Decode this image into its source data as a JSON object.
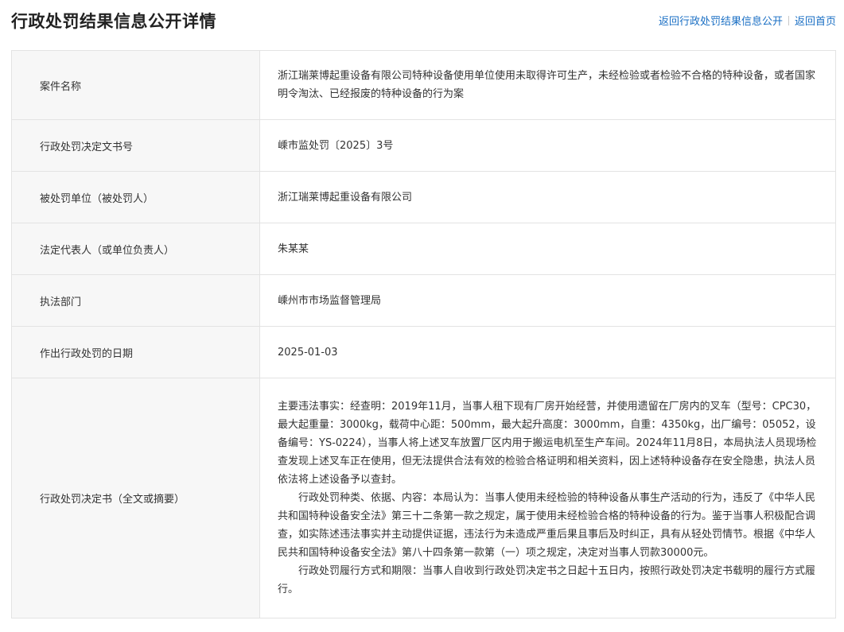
{
  "header": {
    "title": "行政处罚结果信息公开详情",
    "nav_back_list": "返回行政处罚结果信息公开",
    "nav_home": "返回首页"
  },
  "rows": [
    {
      "label": "案件名称",
      "value": "浙江瑞莱博起重设备有限公司特种设备使用单位使用未取得许可生产，未经检验或者检验不合格的特种设备，或者国家明令淘汰、已经报废的特种设备的行为案"
    },
    {
      "label": "行政处罚决定文书号",
      "value": "嵊市监处罚〔2025〕3号"
    },
    {
      "label": "被处罚单位（被处罚人）",
      "value": "浙江瑞莱博起重设备有限公司"
    },
    {
      "label": "法定代表人（或单位负责人）",
      "value": "朱某某"
    },
    {
      "label": "执法部门",
      "value": "嵊州市市场监督管理局"
    },
    {
      "label": "作出行政处罚的日期",
      "value": "2025-01-03"
    },
    {
      "label": "行政处罚决定书（全文或摘要）",
      "paragraphs": [
        "主要违法事实：经查明：2019年11月，当事人租下现有厂房开始经营，并使用遗留在厂房内的叉车（型号：CPC30，最大起重量：3000kg，载荷中心距：500mm，最大起升高度：3000mm，自重：4350kg，出厂编号：05052，设备编号：YS-0224），当事人将上述叉车放置厂区内用于搬运电机至生产车间。2024年11月8日，本局执法人员现场检查发现上述叉车正在使用，但无法提供合法有效的检验合格证明和相关资料，因上述特种设备存在安全隐患，执法人员依法将上述设备予以查封。",
        "行政处罚种类、依据、内容：本局认为：当事人使用未经检验的特种设备从事生产活动的行为，违反了《中华人民共和国特种设备安全法》第三十二条第一款之规定，属于使用未经检验合格的特种设备的行为。鉴于当事人积极配合调查，如实陈述违法事实并主动提供证据，违法行为未造成严重后果且事后及时纠正，具有从轻处罚情节。根据《中华人民共和国特种设备安全法》第八十四条第一款第（一）项之规定，决定对当事人罚款30000元。",
        "行政处罚履行方式和期限：当事人自收到行政处罚决定书之日起十五日内，按照行政处罚决定书载明的履行方式履行。"
      ]
    }
  ]
}
